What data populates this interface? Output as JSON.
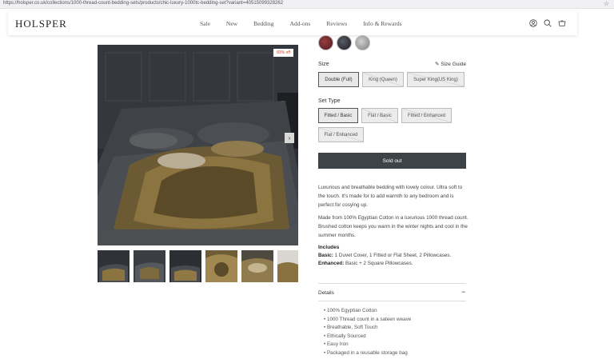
{
  "browser": {
    "url": "https://holsper.co.uk/collections/1000-thread-count-bedding-sets/products/chic-luxury-1000tc-bedding-set?variant=40515099328262",
    "star_icon": "star-icon"
  },
  "header": {
    "logo": "HOLSPER",
    "nav": [
      "Sale",
      "New",
      "Bedding",
      "Add-ons",
      "Reviews",
      "Info & Rewards"
    ],
    "icons": [
      "account-icon",
      "search-icon",
      "cart-icon"
    ]
  },
  "gallery": {
    "badge": "83% off",
    "next_icon": "chevron-right-icon",
    "thumb_count": 6
  },
  "swatches": {
    "colors": [
      "#6a2a2e",
      "#2a2c33",
      "#a9a9a9"
    ]
  },
  "size": {
    "label": "Size",
    "guide": "Size Guide",
    "options": [
      "Double (Full)",
      "King (Queen)",
      "Super King(US King)"
    ]
  },
  "set_type": {
    "label": "Set Type",
    "options": [
      "Fitted / Basic",
      "Flat / Basic",
      "Fitted / Enhanced",
      "Flat / Enhanced"
    ]
  },
  "button": {
    "sold_out": "Sold out"
  },
  "description": {
    "p1": "Luxurious and breathable bedding with lovely colour. Ultra soft to the touch. It's made for to add warmth to any bedroom and is perfect for cosying up.",
    "p2": "Made from 100% Egyptian Cotton in a luxurious 1000 thread count. Brushed cotton keeps you warm in the winter nights and cool in the summer months."
  },
  "includes": {
    "title": "Includes",
    "basic_label": "Basic:",
    "basic_text": "1 Duvet Cover, 1 Fitted or Flat Sheet, 2 Pillowcases.",
    "enhanced_label": "Enhanced:",
    "enhanced_text": "Basic + 2 Square Pillowcases."
  },
  "details": {
    "title": "Details",
    "toggle": "−",
    "items": [
      "100% Egyptian Cotton",
      "1000 Thread count in a sateen weave",
      "Breathable, Soft Touch",
      "Ethically Sourced",
      "Easy Iron",
      "Packaged in a reusable storage bag"
    ]
  }
}
